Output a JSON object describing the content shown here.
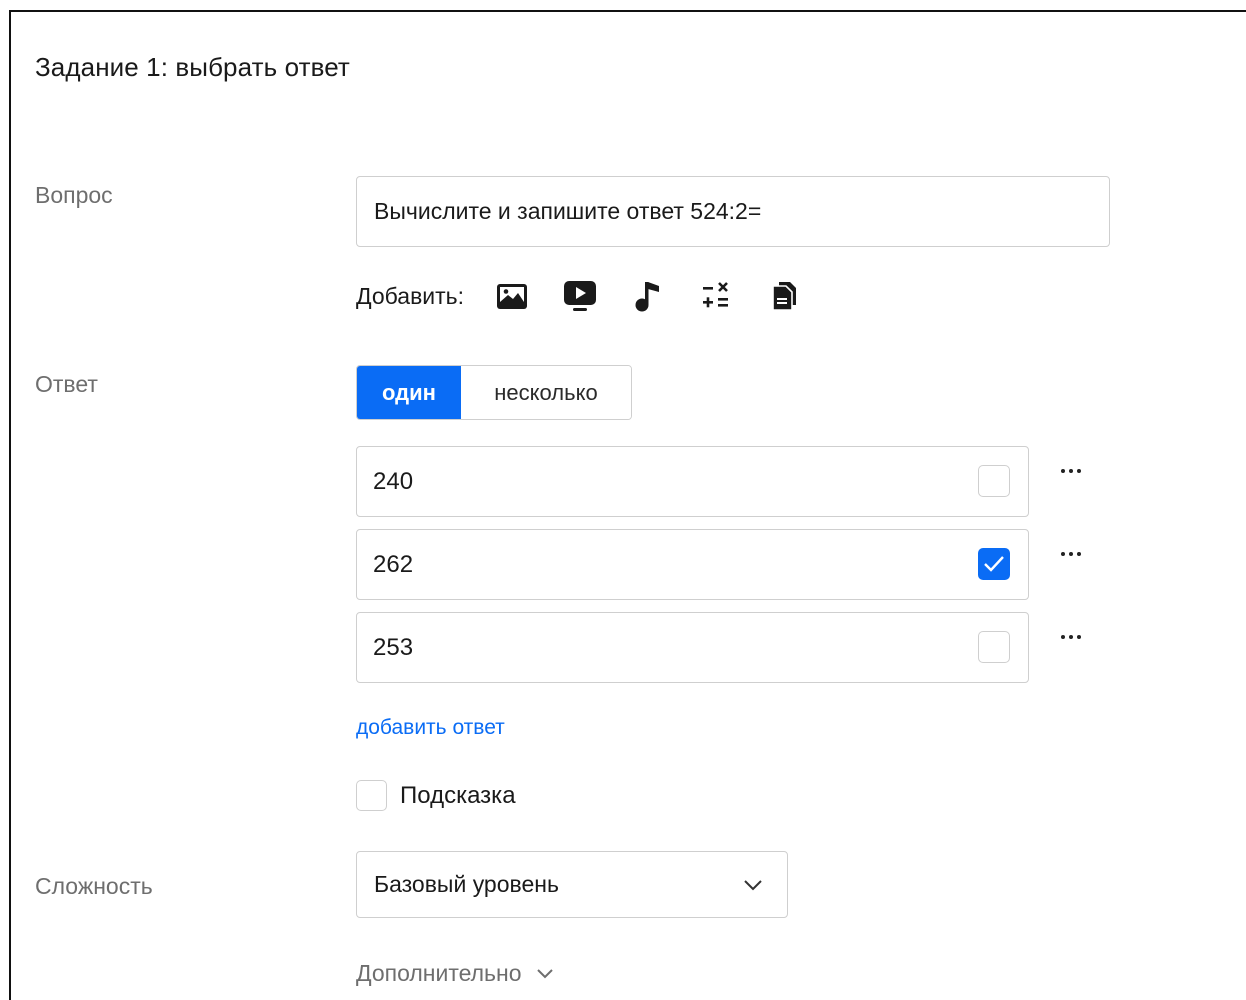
{
  "task": {
    "title": "Задание 1: выбрать ответ"
  },
  "question": {
    "label": "Вопрос",
    "value": "Вычислите и запишите ответ 524:2=",
    "add_label": "Добавить:",
    "add_icons": [
      "image-icon",
      "video-icon",
      "music-note-icon",
      "math-operations-icon",
      "document-icon"
    ]
  },
  "answer": {
    "label": "Ответ",
    "mode_single": "один",
    "mode_multiple": "несколько",
    "selected_mode": "один",
    "options": [
      {
        "value": "240",
        "correct": false
      },
      {
        "value": "262",
        "correct": true
      },
      {
        "value": "253",
        "correct": false
      }
    ],
    "add_answer": "добавить ответ"
  },
  "hint": {
    "label": "Подсказка",
    "checked": false
  },
  "difficulty": {
    "label": "Сложность",
    "selected": "Базовый уровень"
  },
  "extra": {
    "label": "Дополнительно"
  },
  "colors": {
    "accent": "#0a6cf5",
    "label_gray": "#6e6e6e",
    "border": "#cfcfcf"
  }
}
